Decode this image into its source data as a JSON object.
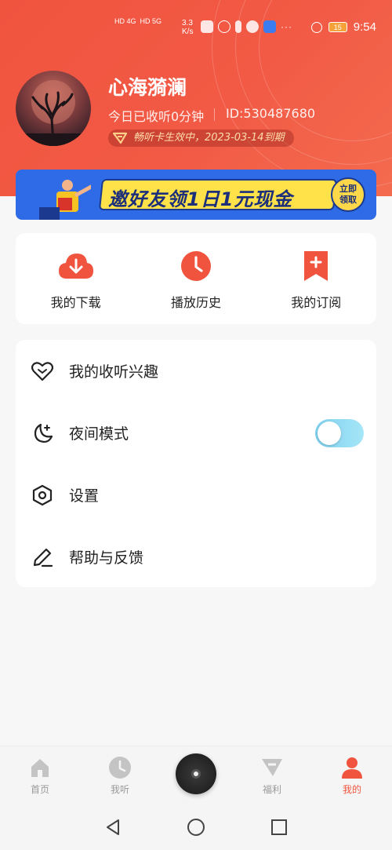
{
  "status_bar": {
    "left_indicators": "HD 4G  HD 5G",
    "net_speed": "3.3\nK/s",
    "dots": "···",
    "battery": "15",
    "time": "9:54"
  },
  "profile": {
    "username": "心海漪澜",
    "listen_today": "今日已收听0分钟",
    "user_id": "ID:530487680",
    "vip_text": "畅听卡生效中，2023-03-14到期"
  },
  "banner": {
    "text": "邀好友领1日1元现金",
    "badge_line1": "立即",
    "badge_line2": "领取"
  },
  "quick_actions": [
    {
      "label": "我的下载",
      "icon": "cloud-download-icon"
    },
    {
      "label": "播放历史",
      "icon": "clock-icon"
    },
    {
      "label": "我的订阅",
      "icon": "bookmark-plus-icon"
    }
  ],
  "menu": {
    "interest": "我的收听兴趣",
    "night_mode": "夜间模式",
    "night_mode_on": false,
    "settings": "设置",
    "help": "帮助与反馈"
  },
  "tabs": [
    {
      "label": "首页",
      "icon": "home-icon",
      "active": false
    },
    {
      "label": "我听",
      "icon": "clock-icon",
      "active": false
    },
    {
      "label": "福利",
      "icon": "v-logo-icon",
      "active": false
    },
    {
      "label": "我的",
      "icon": "person-icon",
      "active": true
    }
  ],
  "colors": {
    "accent": "#f0543f",
    "toggle": "#7fd0f0"
  }
}
